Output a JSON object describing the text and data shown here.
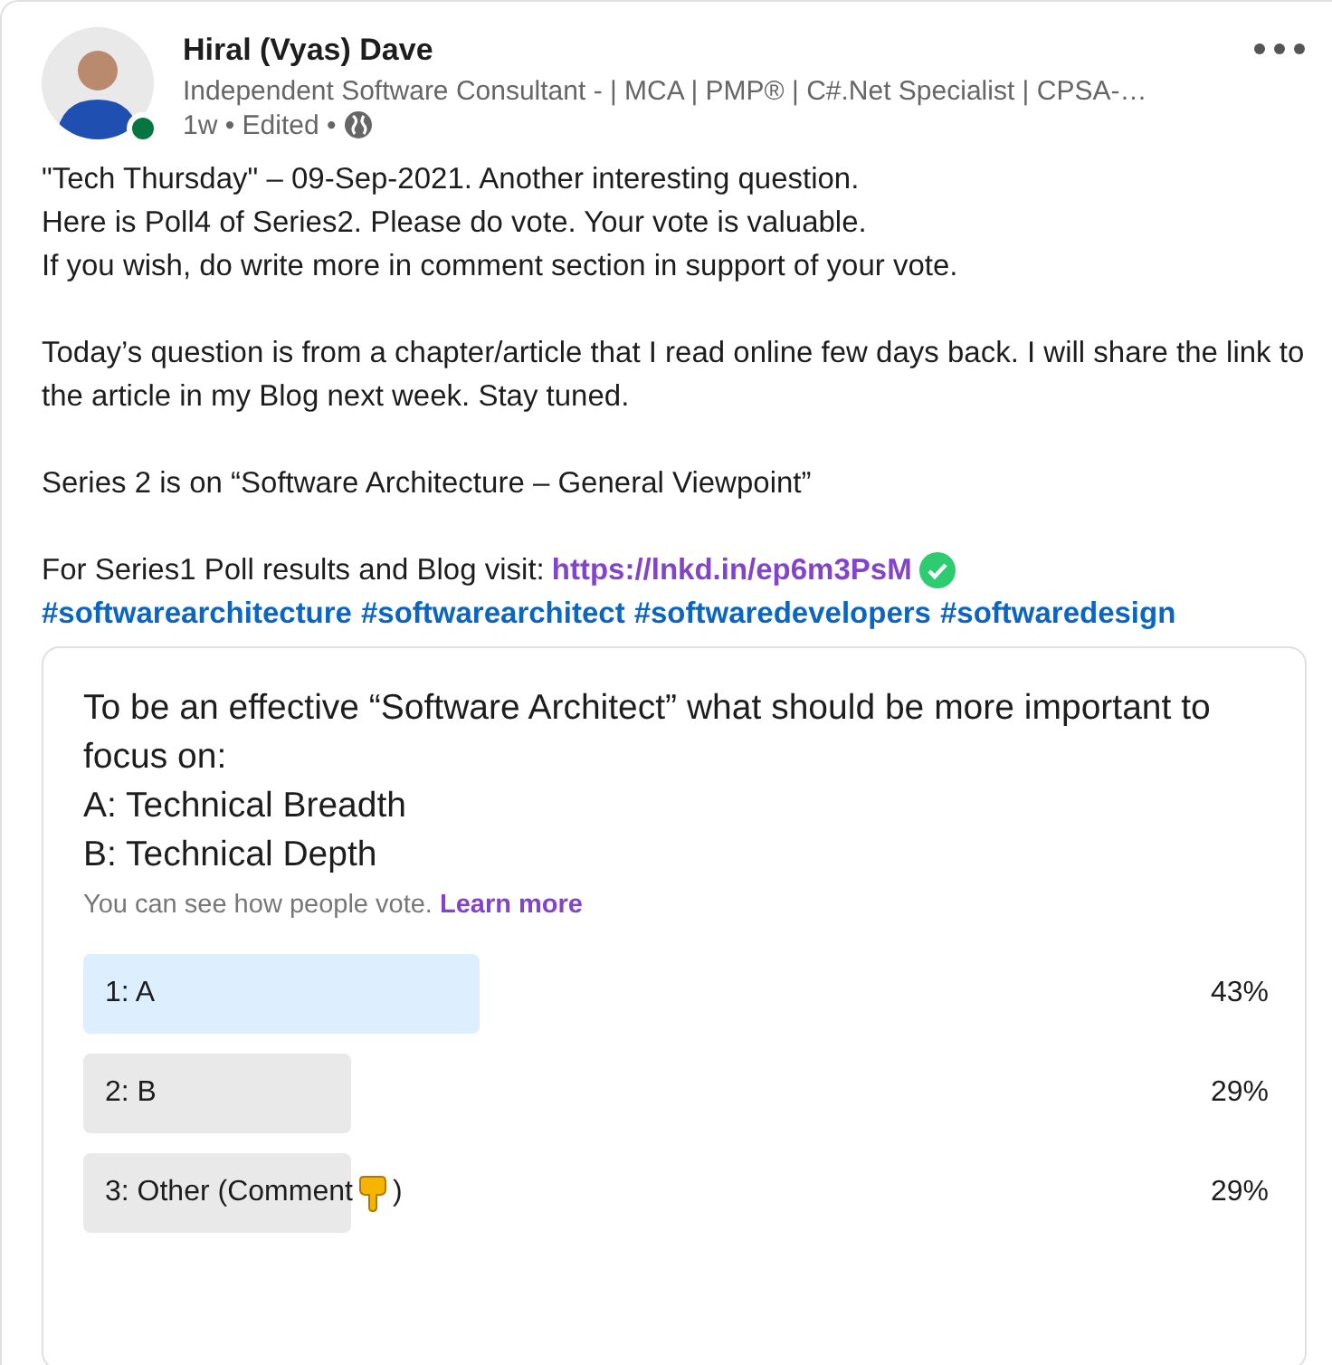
{
  "author": {
    "name": "Hiral (Vyas) Dave",
    "headline": "Independent Software Consultant - | MCA | PMP® | C#.Net Specialist | CPSA-…",
    "online": true,
    "time": "1w • Edited •"
  },
  "body": {
    "paragraphs": [
      [
        "\"Tech Thursday\" – 09-Sep-2021. Another interesting question.",
        "Here is Poll4 of Series2. Please do vote. Your vote is valuable.",
        "If you wish, do write more in comment section in support of your vote."
      ],
      [
        "Today’s question is from a chapter/article that I read online few days back. I will share the link to the article in my Blog next week. Stay tuned."
      ],
      [
        "Series 2 is on “Software Architecture – General Viewpoint”"
      ]
    ],
    "link_intro": "For Series1 Poll results and Blog visit:",
    "link": "https://lnkd.in/ep6m3PsM",
    "hashtags": [
      "#softwarearchitecture",
      "#softwarearchitect",
      "#softwaredevelopers",
      "#softwaredesign"
    ]
  },
  "poll": {
    "question": [
      "To be an effective “Software Architect” what should be more important to focus on:",
      "A: Technical Breadth",
      "B: Technical Depth"
    ],
    "note": "You can see how people vote.",
    "learn_more": "Learn more",
    "options": [
      {
        "label": "1: A",
        "selected": true,
        "percent": "43%"
      },
      {
        "label": "2: B",
        "selected": false,
        "percent": "29%"
      },
      {
        "label": "3: Other (Comment",
        "label_end": ")",
        "kind": "pointing",
        "selected": false,
        "percent": "29%"
      }
    ]
  }
}
